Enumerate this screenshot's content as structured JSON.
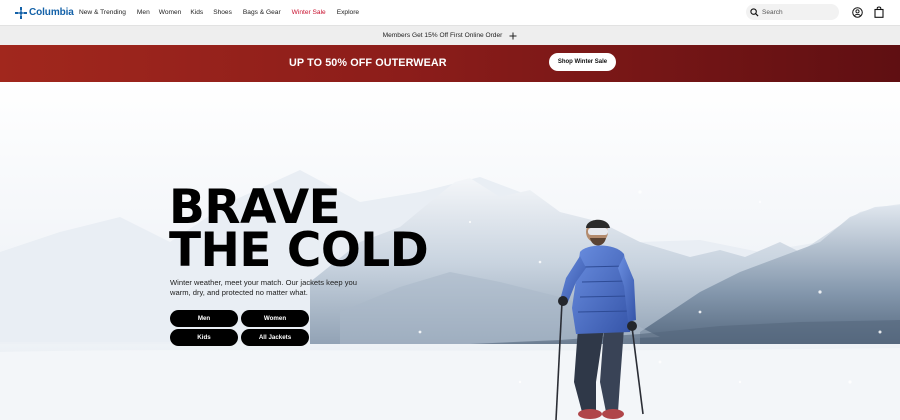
{
  "brand": {
    "name": "Columbia",
    "color": "#1361a8"
  },
  "nav": {
    "items": [
      {
        "label": "New & Trending"
      },
      {
        "label": "Men"
      },
      {
        "label": "Women"
      },
      {
        "label": "Kids"
      },
      {
        "label": "Shoes"
      },
      {
        "label": "Bags & Gear"
      },
      {
        "label": "Winter Sale",
        "color": "#c8102e"
      },
      {
        "label": "Explore"
      }
    ]
  },
  "search": {
    "placeholder": "Search",
    "icon": "search-icon"
  },
  "header_icons": {
    "account": "account-icon",
    "bag": "shopping-bag-icon"
  },
  "promo_strip": {
    "text": "Members Get 15% Off First Online Order",
    "icon": "plus-icon"
  },
  "sale_banner": {
    "heading": "UP TO 50% OFF OUTERWEAR",
    "button": "Shop Winter Sale",
    "colors": [
      "#a1271d",
      "#5f0f12"
    ]
  },
  "hero": {
    "title_line1": "BRAVE",
    "title_line2": "THE COLD",
    "subtitle": "Winter weather, meet your match. Our jackets keep you warm, dry, and protected no matter what.",
    "buttons": [
      "Men",
      "Women",
      "Kids",
      "All Jackets"
    ],
    "jacket_color": "#4a6fc4"
  }
}
